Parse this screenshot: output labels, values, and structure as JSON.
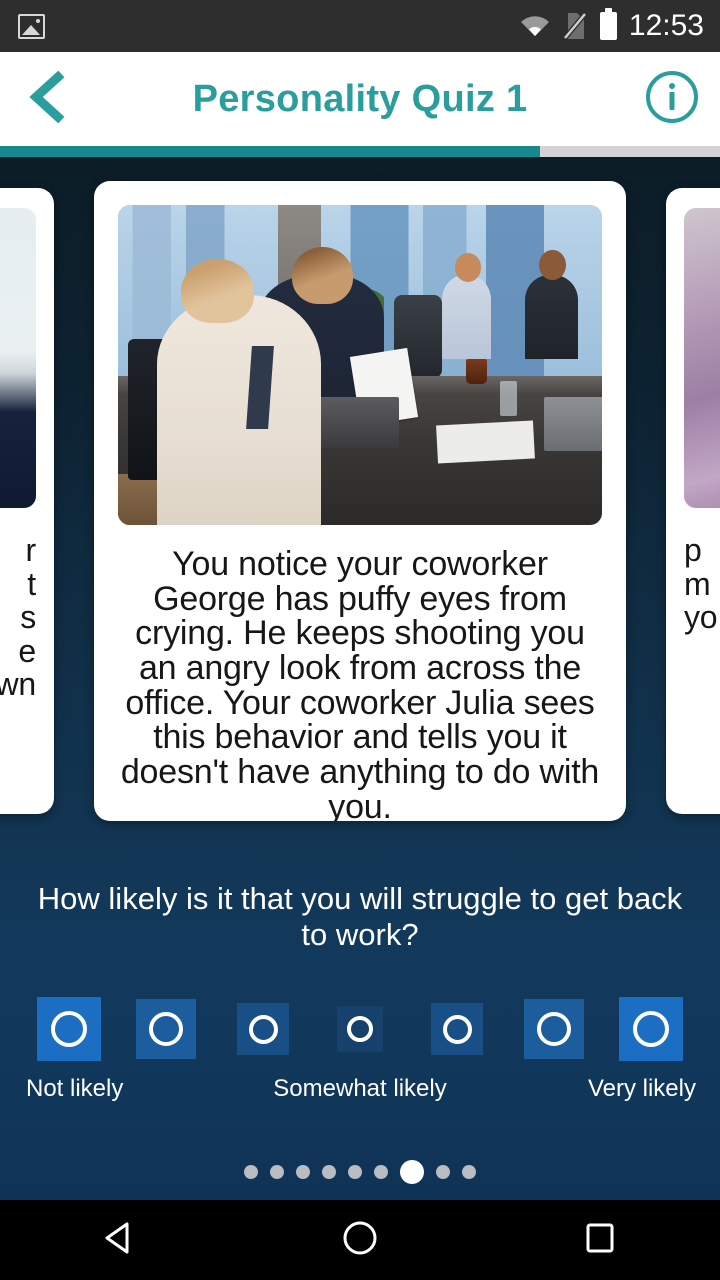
{
  "status_bar": {
    "image_icon": "image-badge-icon",
    "wifi_icon": "wifi-icon",
    "sim_icon": "no-sim-icon",
    "battery_icon": "battery-icon",
    "time": "12:53"
  },
  "header": {
    "back_icon": "chevron-left-icon",
    "title": "Personality Quiz 1",
    "info_icon": "info-circle-icon",
    "accent_color": "#2a9d9d"
  },
  "progress": {
    "percent": 75,
    "fill_color": "#17888d",
    "track_color": "#d5d2d4"
  },
  "carousel": {
    "prev_card": {
      "image_alt": "bedroom-photo",
      "text_fragment": "r\nt\ns\ne\nwn"
    },
    "current_card": {
      "image_alt": "office-meeting-photo",
      "text": "You notice your coworker George has puffy eyes from crying. He keeps shooting you an angry look from across the office. Your coworker Julia sees this behavior and tells you it doesn't have anything to do with you."
    },
    "next_card": {
      "image_alt": "pink-fabric-photo",
      "text_fragment": "p\nm\nyo"
    }
  },
  "question": {
    "text": "How likely is it that you will struggle to get back to work?"
  },
  "rating": {
    "options": [
      {
        "value": 1,
        "size": 64,
        "color": "#1b6ec2"
      },
      {
        "value": 2,
        "size": 60,
        "color": "#1c5d9e"
      },
      {
        "value": 3,
        "size": 52,
        "color": "#184f86"
      },
      {
        "value": 4,
        "size": 46,
        "color": "#16416d"
      },
      {
        "value": 5,
        "size": 52,
        "color": "#184f86"
      },
      {
        "value": 6,
        "size": 60,
        "color": "#1c5d9e"
      },
      {
        "value": 7,
        "size": 64,
        "color": "#1b6ec2"
      }
    ],
    "label_low": "Not likely",
    "label_mid": "Somewhat likely",
    "label_high": "Very likely",
    "selected": null
  },
  "pagination": {
    "total": 9,
    "active_index": 6
  },
  "navbar": {
    "back_icon": "triangle-back-icon",
    "home_icon": "circle-home-icon",
    "recents_icon": "square-recents-icon"
  }
}
